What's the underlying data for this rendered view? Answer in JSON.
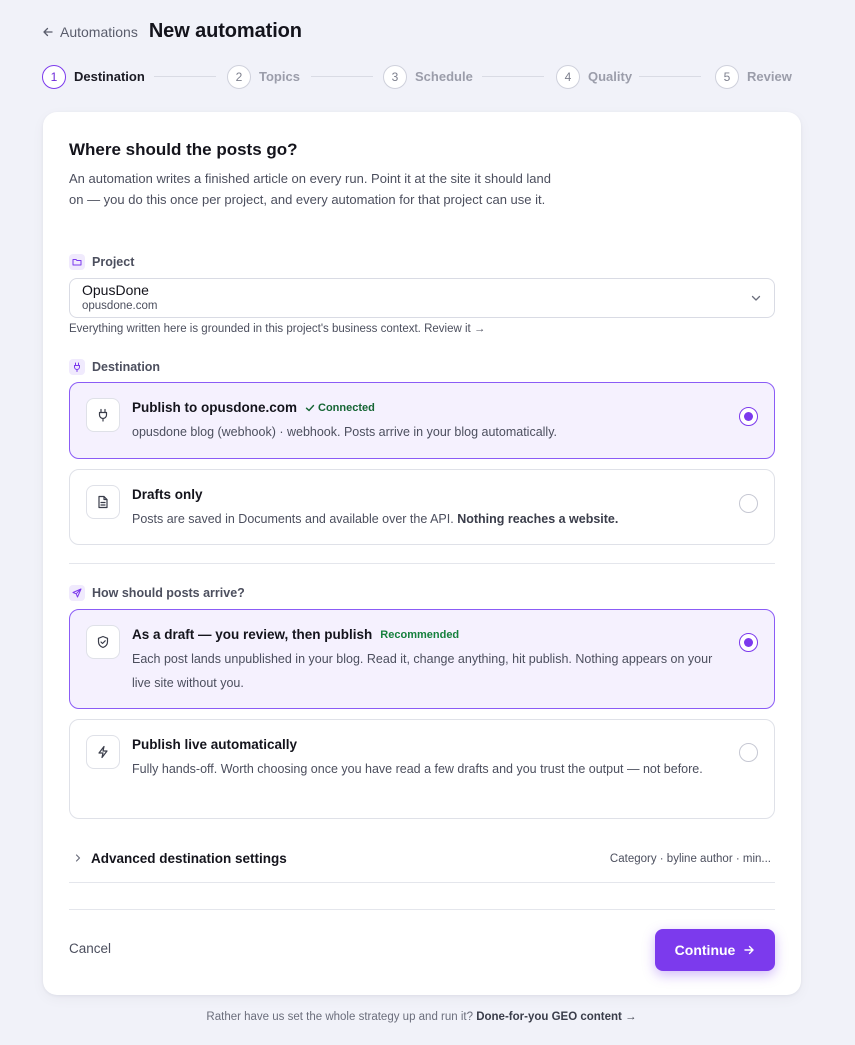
{
  "header": {
    "back_label": "Automations",
    "title": "New automation"
  },
  "steps": [
    {
      "num": "1",
      "label": "Destination",
      "active": true
    },
    {
      "num": "2",
      "label": "Topics"
    },
    {
      "num": "3",
      "label": "Schedule"
    },
    {
      "num": "4",
      "label": "Quality"
    },
    {
      "num": "5",
      "label": "Review"
    }
  ],
  "card": {
    "question": "Where should the posts go?",
    "intro": "An automation writes a finished article on every run. Point it at the site it should land on — you do this once per project, and every automation for that project can use it."
  },
  "project": {
    "label": "Project",
    "name": "OpusDone",
    "domain": "opusdone.com",
    "helper": "Everything written here is grounded in this project's business context.",
    "helper_link": "Review it →"
  },
  "destination": {
    "label": "Destination",
    "options": [
      {
        "title": "Publish to opusdone.com",
        "badge": "Connected",
        "desc": "opusdone blog (webhook) · webhook. Posts arrive in your blog automatically.",
        "selected": true
      },
      {
        "title": "Drafts only",
        "desc": "Posts are saved in Documents and available over the API.",
        "desc_bold": "Nothing reaches a website.",
        "selected": false
      }
    ]
  },
  "arrival": {
    "label": "How should posts arrive?",
    "options": [
      {
        "title": "As a draft — you review, then publish",
        "badge": "Recommended",
        "desc": "Each post lands unpublished in your blog. Read it, change anything, hit publish. Nothing appears on your live site without you.",
        "selected": true
      },
      {
        "title": "Publish live automatically",
        "desc": "Fully hands-off. Worth choosing once you have read a few drafts and you trust the output — not before.",
        "selected": false
      }
    ]
  },
  "advanced": {
    "title": "Advanced destination settings",
    "meta": "Category · byline author · min..."
  },
  "actions": {
    "cancel": "Cancel",
    "continue": "Continue"
  },
  "footer": {
    "text": "Rather have us set the whole strategy up and run it?",
    "link": "Done-for-you GEO content →"
  },
  "colors": {
    "accent": "#7c3aed",
    "selected_bg": "#f5f1fe",
    "page_bg": "#f1f2f9",
    "success": "#15803d"
  },
  "icons": {
    "back": "arrow-left-icon",
    "project": "folder-icon",
    "destination": "plug-icon",
    "arrival": "send-icon",
    "publish": "plug-icon",
    "drafts": "document-icon",
    "draft_review": "shield-check-icon",
    "live": "lightning-icon"
  }
}
